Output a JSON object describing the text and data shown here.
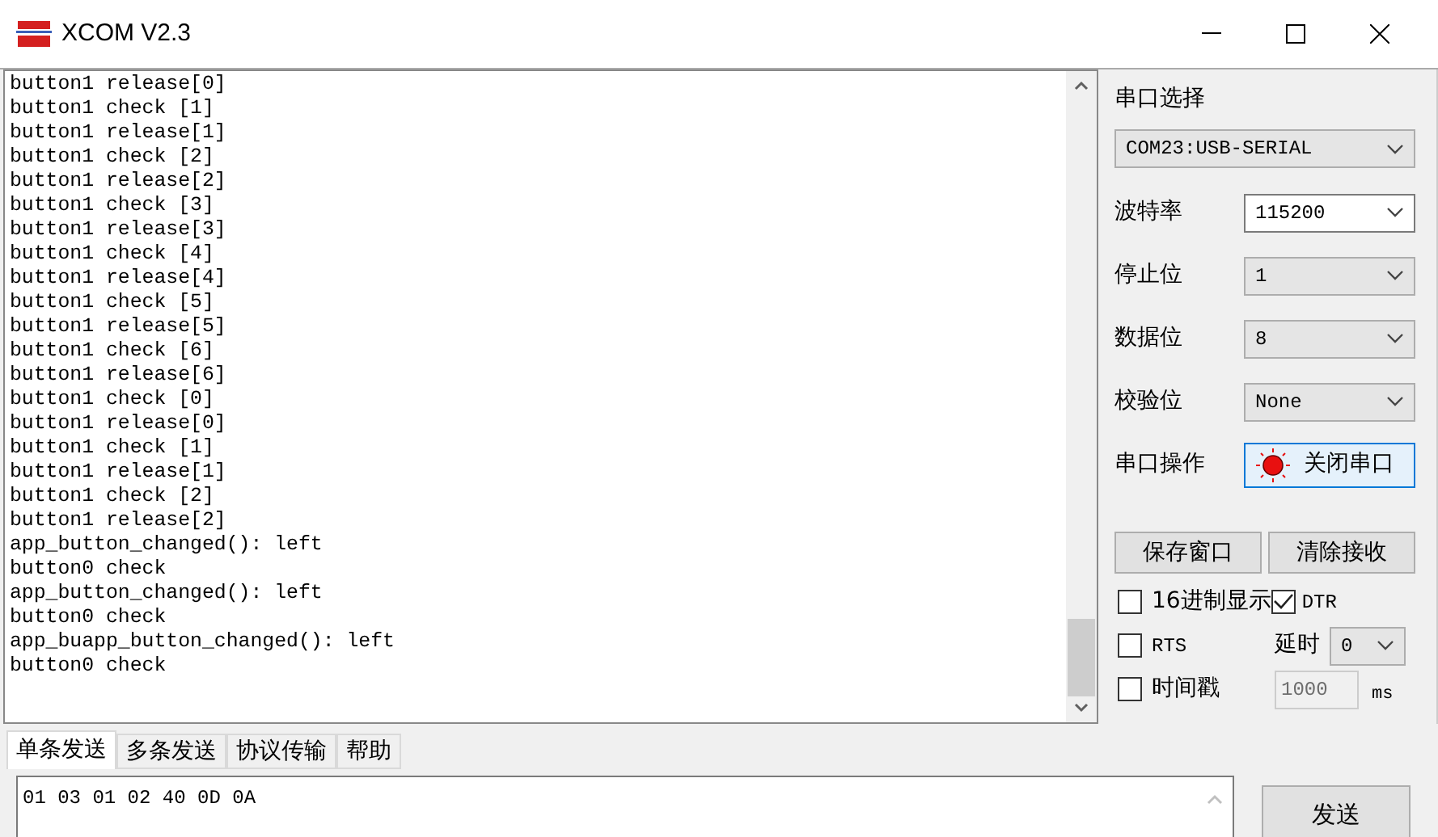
{
  "window": {
    "title": "XCOM V2.3"
  },
  "log": {
    "lines": [
      "button1 release[0]",
      "button1 check [1]",
      "button1 release[1]",
      "button1 check [2]",
      "button1 release[2]",
      "button1 check [3]",
      "button1 release[3]",
      "button1 check [4]",
      "button1 release[4]",
      "button1 check [5]",
      "button1 release[5]",
      "button1 check [6]",
      "button1 release[6]",
      "button1 check [0]",
      "button1 release[0]",
      "button1 check [1]",
      "button1 release[1]",
      "button1 check [2]",
      "button1 release[2]",
      "app_button_changed(): left",
      "button0 check",
      "app_button_changed(): left",
      "button0 check",
      "app_buapp_button_changed(): left",
      "button0 check"
    ]
  },
  "serial": {
    "port_label": "串口选择",
    "port": "COM23:USB-SERIAL",
    "fields": [
      {
        "label": "波特率",
        "value": "115200",
        "editable": true
      },
      {
        "label": "停止位",
        "value": "1",
        "editable": false
      },
      {
        "label": "数据位",
        "value": "8",
        "editable": false
      },
      {
        "label": "校验位",
        "value": "None",
        "editable": false
      }
    ],
    "operate_label": "串口操作",
    "operate_button": {
      "label": "关闭串口",
      "open": true
    }
  },
  "buttons": [
    "保存窗口",
    "清除接收"
  ],
  "options": [
    {
      "label": "16进制显示",
      "checked": false
    },
    {
      "label": "DTR",
      "checked": true
    },
    {
      "label": "RTS",
      "checked": false
    },
    {
      "label": "时间戳",
      "checked": false
    }
  ],
  "delay": {
    "label": "延时",
    "value": "0"
  },
  "interval": {
    "value": "1000",
    "unit": "ms"
  },
  "tabs": [
    {
      "label": "单条发送",
      "selected": true
    },
    {
      "label": "多条发送",
      "selected": false
    },
    {
      "label": "协议传输",
      "selected": false
    },
    {
      "label": "帮助",
      "selected": false
    }
  ],
  "send": {
    "value": "01 03 01 02 40 0D 0A",
    "button": "发送"
  }
}
